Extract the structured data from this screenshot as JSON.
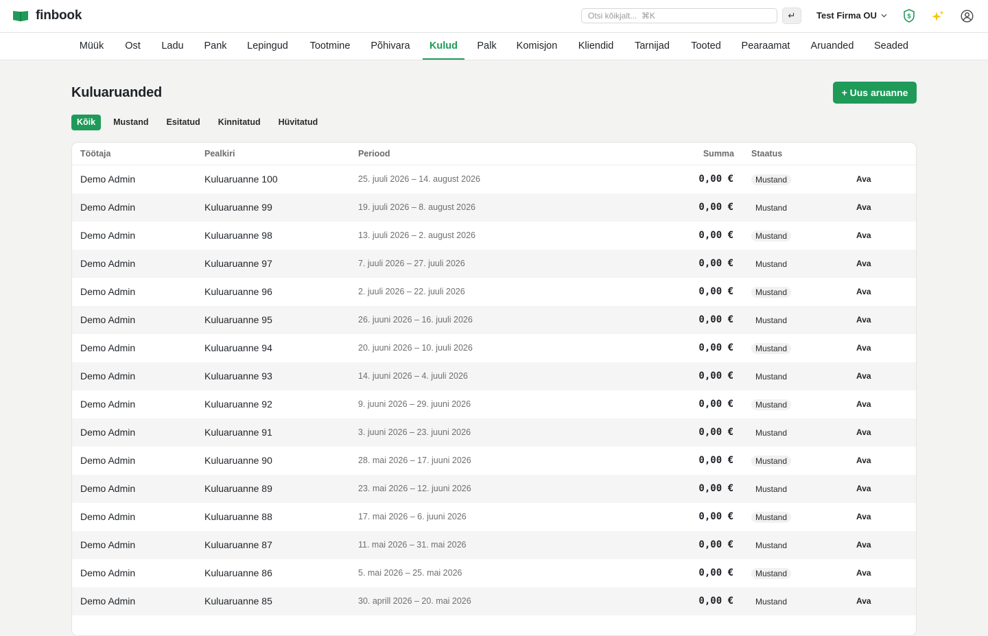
{
  "app": {
    "name": "finbook",
    "brand_color": "#1f9a59"
  },
  "header": {
    "search_placeholder": "Otsi kõikjalt...  ⌘K",
    "enter_symbol": "↵",
    "company": "Test Firma OU",
    "icons": [
      "shield-icon",
      "sparkle-icon",
      "user-circle-icon"
    ]
  },
  "nav": {
    "items": [
      {
        "label": "Müük"
      },
      {
        "label": "Ost"
      },
      {
        "label": "Ladu"
      },
      {
        "label": "Pank"
      },
      {
        "label": "Lepingud"
      },
      {
        "label": "Tootmine"
      },
      {
        "label": "Põhivara"
      },
      {
        "label": "Kulud",
        "active": true
      },
      {
        "label": "Palk"
      },
      {
        "label": "Komisjon"
      },
      {
        "label": "Kliendid"
      },
      {
        "label": "Tarnijad"
      },
      {
        "label": "Tooted"
      },
      {
        "label": "Pearaamat"
      },
      {
        "label": "Aruanded"
      },
      {
        "label": "Seaded"
      }
    ]
  },
  "page": {
    "title": "Kuluaruanded",
    "new_button": "+ Uus aruanne"
  },
  "filters": [
    {
      "label": "Kõik",
      "active": true
    },
    {
      "label": "Mustand"
    },
    {
      "label": "Esitatud"
    },
    {
      "label": "Kinnitatud"
    },
    {
      "label": "Hüvitatud"
    }
  ],
  "table": {
    "headers": {
      "employee": "Töötaja",
      "title": "Pealkiri",
      "period": "Periood",
      "sum": "Summa",
      "status": "Staatus"
    },
    "rows": [
      {
        "employee": "Demo Admin",
        "title": "Kuluaruanne 100",
        "period": "25. juuli 2026 – 14. august 2026",
        "sum": "0,00 €",
        "status": "Mustand",
        "action": "Ava"
      },
      {
        "employee": "Demo Admin",
        "title": "Kuluaruanne 99",
        "period": "19. juuli 2026 – 8. august 2026",
        "sum": "0,00 €",
        "status": "Mustand",
        "action": "Ava"
      },
      {
        "employee": "Demo Admin",
        "title": "Kuluaruanne 98",
        "period": "13. juuli 2026 – 2. august 2026",
        "sum": "0,00 €",
        "status": "Mustand",
        "action": "Ava"
      },
      {
        "employee": "Demo Admin",
        "title": "Kuluaruanne 97",
        "period": "7. juuli 2026 – 27. juuli 2026",
        "sum": "0,00 €",
        "status": "Mustand",
        "action": "Ava"
      },
      {
        "employee": "Demo Admin",
        "title": "Kuluaruanne 96",
        "period": "2. juuli 2026 – 22. juuli 2026",
        "sum": "0,00 €",
        "status": "Mustand",
        "action": "Ava"
      },
      {
        "employee": "Demo Admin",
        "title": "Kuluaruanne 95",
        "period": "26. juuni 2026 – 16. juuli 2026",
        "sum": "0,00 €",
        "status": "Mustand",
        "action": "Ava"
      },
      {
        "employee": "Demo Admin",
        "title": "Kuluaruanne 94",
        "period": "20. juuni 2026 – 10. juuli 2026",
        "sum": "0,00 €",
        "status": "Mustand",
        "action": "Ava"
      },
      {
        "employee": "Demo Admin",
        "title": "Kuluaruanne 93",
        "period": "14. juuni 2026 – 4. juuli 2026",
        "sum": "0,00 €",
        "status": "Mustand",
        "action": "Ava"
      },
      {
        "employee": "Demo Admin",
        "title": "Kuluaruanne 92",
        "period": "9. juuni 2026 – 29. juuni 2026",
        "sum": "0,00 €",
        "status": "Mustand",
        "action": "Ava"
      },
      {
        "employee": "Demo Admin",
        "title": "Kuluaruanne 91",
        "period": "3. juuni 2026 – 23. juuni 2026",
        "sum": "0,00 €",
        "status": "Mustand",
        "action": "Ava"
      },
      {
        "employee": "Demo Admin",
        "title": "Kuluaruanne 90",
        "period": "28. mai 2026 – 17. juuni 2026",
        "sum": "0,00 €",
        "status": "Mustand",
        "action": "Ava"
      },
      {
        "employee": "Demo Admin",
        "title": "Kuluaruanne 89",
        "period": "23. mai 2026 – 12. juuni 2026",
        "sum": "0,00 €",
        "status": "Mustand",
        "action": "Ava"
      },
      {
        "employee": "Demo Admin",
        "title": "Kuluaruanne 88",
        "period": "17. mai 2026 – 6. juuni 2026",
        "sum": "0,00 €",
        "status": "Mustand",
        "action": "Ava"
      },
      {
        "employee": "Demo Admin",
        "title": "Kuluaruanne 87",
        "period": "11. mai 2026 – 31. mai 2026",
        "sum": "0,00 €",
        "status": "Mustand",
        "action": "Ava"
      },
      {
        "employee": "Demo Admin",
        "title": "Kuluaruanne 86",
        "period": "5. mai 2026 – 25. mai 2026",
        "sum": "0,00 €",
        "status": "Mustand",
        "action": "Ava"
      },
      {
        "employee": "Demo Admin",
        "title": "Kuluaruanne 85",
        "period": "30. aprill 2026 – 20. mai 2026",
        "sum": "0,00 €",
        "status": "Mustand",
        "action": "Ava"
      }
    ]
  }
}
